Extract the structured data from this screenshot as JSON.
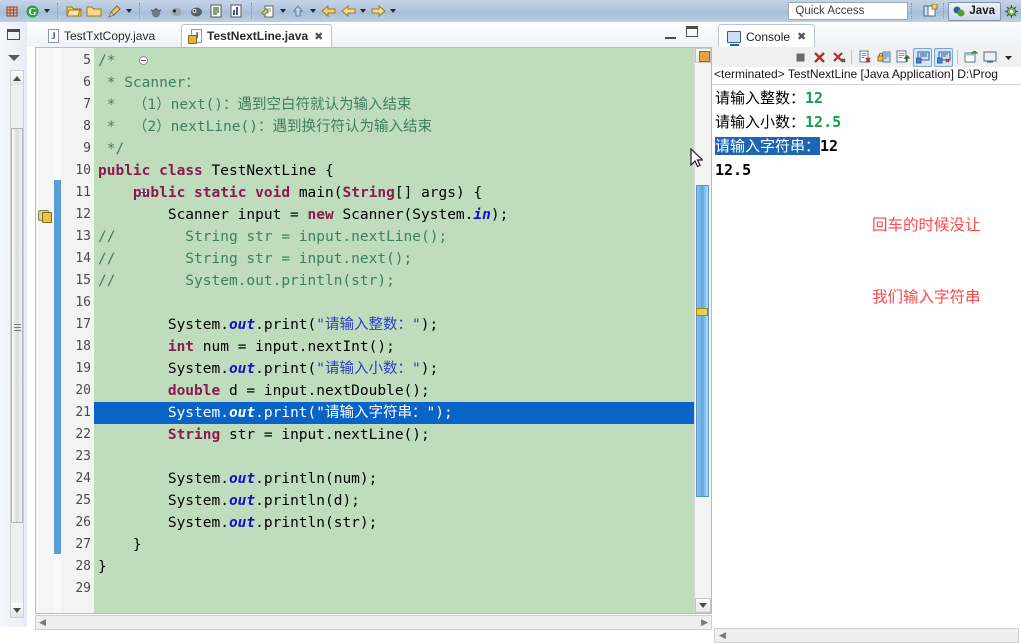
{
  "toolbar": {
    "quick_access_placeholder": "Quick Access",
    "perspective_label": "Java",
    "icons": [
      "new-wizard-icon",
      "grid-icon",
      "google-icon",
      "open-folder-icon",
      "open-folder2-icon",
      "brush-icon",
      "debug-icon",
      "run-icon",
      "coverage-icon",
      "outline-icon",
      "chart-icon",
      "edit-icon",
      "up-arrow-icon",
      "back-icon",
      "forward-yellow-icon",
      "next-icon"
    ]
  },
  "editor": {
    "tabs": [
      {
        "label": "TestTxtCopy.java",
        "active": false
      },
      {
        "label": "TestNextLine.java",
        "active": true,
        "close": "✖"
      }
    ],
    "first_line_number": 5,
    "lines": [
      {
        "n": 5,
        "fold": true,
        "text": "/*"
      },
      {
        "n": 6,
        "text": " * Scanner："
      },
      {
        "n": 7,
        "text": " *  （1）next()：遇到空白符就认为输入结束"
      },
      {
        "n": 8,
        "text": " *  （2）nextLine()：遇到换行符认为输入结束"
      },
      {
        "n": 9,
        "text": " */"
      },
      {
        "n": 10,
        "text": "public class TestNextLine {"
      },
      {
        "n": 11,
        "fold": true,
        "text": "    public static void main(String[] args) {"
      },
      {
        "n": 12,
        "warning": true,
        "text": "        Scanner input = new Scanner(System.in);"
      },
      {
        "n": 13,
        "text": "//        String str = input.nextLine();"
      },
      {
        "n": 14,
        "text": "//        String str = input.next();"
      },
      {
        "n": 15,
        "text": "//        System.out.println(str);"
      },
      {
        "n": 16,
        "text": ""
      },
      {
        "n": 17,
        "text": "        System.out.print(\"请输入整数：\");"
      },
      {
        "n": 18,
        "text": "        int num = input.nextInt();"
      },
      {
        "n": 19,
        "text": "        System.out.print(\"请输入小数：\");"
      },
      {
        "n": 20,
        "text": "        double d = input.nextDouble();"
      },
      {
        "n": 21,
        "selected": true,
        "text": "        System.out.print(\"请输入字符串：\");"
      },
      {
        "n": 22,
        "text": "        String str = input.nextLine();"
      },
      {
        "n": 23,
        "text": ""
      },
      {
        "n": 24,
        "text": "        System.out.println(num);"
      },
      {
        "n": 25,
        "text": "        System.out.println(d);"
      },
      {
        "n": 26,
        "text": "        System.out.println(str);"
      },
      {
        "n": 27,
        "text": "    }"
      },
      {
        "n": 28,
        "text": "}"
      },
      {
        "n": 29,
        "text": ""
      }
    ]
  },
  "console": {
    "tab_label": "Console",
    "tab_close": "✖",
    "header": "<terminated> TestNextLine [Java Application] D:\\Prog",
    "toolbar_icons": [
      "terminate-icon",
      "remove-launch-icon",
      "remove-all-terminated-icon",
      "clear-console-icon",
      "scroll-lock-icon",
      "pin-console-icon",
      "display-selected-console-icon",
      "open-console-icon",
      "new-console-view-icon",
      "console-menu-icon",
      "view-menu-arrow-icon"
    ],
    "output": [
      {
        "prompt": "请输入整数：",
        "value": "12",
        "value_kind": "stdin"
      },
      {
        "prompt": "请输入小数：",
        "value": "12.5",
        "value_kind": "stdin"
      },
      {
        "prompt": "请输入字符串：",
        "value": "12",
        "value_kind": "stdout",
        "prompt_selected": true
      },
      {
        "prompt": "",
        "value": "12.5",
        "value_kind": "stdout"
      }
    ],
    "annotation_line1": "回车的时候没让",
    "annotation_line2": "我们输入字符串",
    "annotation_color": "#fa4a4a"
  },
  "colors": {
    "code_background": "#bfdcbd",
    "selection": "#0a64c8",
    "keyword": "#8a1a50",
    "comment": "#3f7f5f",
    "string": "#2a3ec6",
    "field": "#1111cc",
    "stdin": "#10a050",
    "change_bar": "#5a9ed6"
  }
}
